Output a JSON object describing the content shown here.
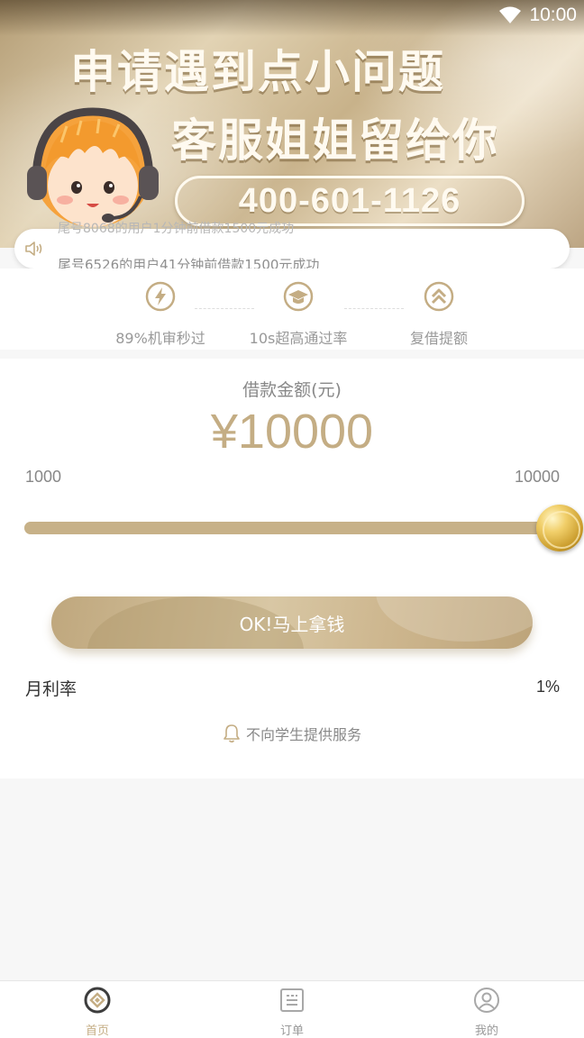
{
  "status_bar": {
    "time": "10:00"
  },
  "banner": {
    "headline_line1": "申请遇到点小问题",
    "headline_line2": "客服姐姐留给你",
    "phone": "400-601-1126"
  },
  "ticker": {
    "ghost_text": "尾号8068的用户1分钟前借款1500元成功",
    "current_text": "尾号6526的用户41分钟前借款1500元成功"
  },
  "features": [
    {
      "icon": "lightning-icon",
      "label": "89%机审秒过"
    },
    {
      "icon": "graduation-cap-icon",
      "label": "10s超高通过率"
    },
    {
      "icon": "double-chevron-up-icon",
      "label": "复借提额"
    }
  ],
  "loan": {
    "amount_label": "借款金额(元)",
    "amount_value": "¥10000",
    "range_min": "1000",
    "range_max": "10000",
    "slider_fraction": 1.0,
    "cta_label": "OK!马上拿钱",
    "rate_label": "月利率",
    "rate_value": "1%",
    "notice": "不向学生提供服务"
  },
  "tabbar": {
    "items": [
      {
        "label": "首页",
        "icon": "home-coin-icon",
        "active": true
      },
      {
        "label": "订单",
        "icon": "order-list-icon",
        "active": false
      },
      {
        "label": "我的",
        "icon": "profile-icon",
        "active": false
      }
    ]
  },
  "colors": {
    "accent": "#c4ad84",
    "gold": "#d9b654",
    "muted": "#999999"
  }
}
